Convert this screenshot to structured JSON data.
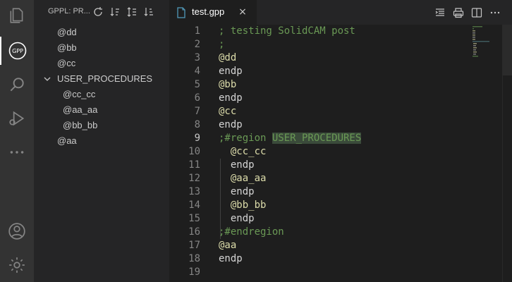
{
  "activity_bar": {
    "items": [
      "explorer-icon",
      "gpp-icon",
      "search-icon",
      "run-debug-icon",
      "more-icon"
    ],
    "bottom": [
      "account-icon",
      "settings-gear-icon"
    ],
    "gpp_text": "GPP"
  },
  "sidebar": {
    "title": "GPPL: PR...",
    "actions": [
      "refresh-icon",
      "sort-ascending-icon",
      "sort-lines-icon",
      "sort-descending-icon"
    ],
    "tree": [
      {
        "label": "@dd",
        "level": 0
      },
      {
        "label": "@bb",
        "level": 0
      },
      {
        "label": "@cc",
        "level": 0
      },
      {
        "label": "USER_PROCEDURES",
        "level": 0,
        "expanded": true
      },
      {
        "label": "@cc_cc",
        "level": 1
      },
      {
        "label": "@aa_aa",
        "level": 1
      },
      {
        "label": "@bb_bb",
        "level": 1
      },
      {
        "label": "@aa",
        "level": 0
      }
    ]
  },
  "tabs": [
    {
      "label": "test.gpp",
      "active": true,
      "close": "×"
    }
  ],
  "editor_actions": [
    "outline-toggle-icon",
    "print-icon",
    "split-editor-icon",
    "more-actions-icon"
  ],
  "editor": {
    "current_line": 9,
    "lines": [
      {
        "n": "1",
        "text": "; testing SolidCAM post"
      },
      {
        "n": "2",
        "text": ";"
      },
      {
        "n": "3",
        "text": "@dd"
      },
      {
        "n": "4",
        "text": "endp"
      },
      {
        "n": "5",
        "text": "@bb"
      },
      {
        "n": "6",
        "text": "endp"
      },
      {
        "n": "7",
        "text": "@cc"
      },
      {
        "n": "8",
        "text": "endp"
      },
      {
        "n": "9",
        "text": ";#region ",
        "highlight": "USER_PROCEDURES"
      },
      {
        "n": "10",
        "text": "  @cc_cc"
      },
      {
        "n": "11",
        "text": "  endp"
      },
      {
        "n": "12",
        "text": "  @aa_aa"
      },
      {
        "n": "13",
        "text": "  endp"
      },
      {
        "n": "14",
        "text": "  @bb_bb"
      },
      {
        "n": "15",
        "text": "  endp"
      },
      {
        "n": "16",
        "text": ";#endregion"
      },
      {
        "n": "17",
        "text": "@aa"
      },
      {
        "n": "18",
        "text": "endp"
      },
      {
        "n": "19",
        "text": ""
      }
    ]
  },
  "colors": {
    "comment": "#6a9955",
    "label": "#dcdcaa",
    "keyword": "#d4d4d4",
    "active_tab_icon": "#519aba"
  }
}
